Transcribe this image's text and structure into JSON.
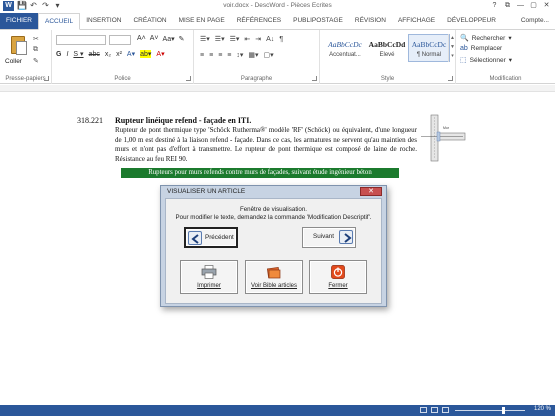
{
  "window": {
    "title": "voir.docx - DescWord - Pièces Ecrites",
    "controls": [
      "?",
      "⧉",
      "—",
      "▢",
      "✕"
    ]
  },
  "qat": {
    "logo": "W",
    "save": "💾",
    "undo": "↶",
    "redo": "↷",
    "more": "▾"
  },
  "tabs": [
    "FICHIER",
    "ACCUEIL",
    "INSERTION",
    "CRÉATION",
    "MISE EN PAGE",
    "RÉFÉRENCES",
    "PUBLIPOSTAGE",
    "RÉVISION",
    "AFFICHAGE",
    "DÉVELOPPEUR"
  ],
  "account": "Compte...",
  "ribbon": {
    "clipboard": {
      "paste_label": "Coller",
      "group_label": "Presse-papiers"
    },
    "font": {
      "group_label": "Police",
      "grow": "A˄",
      "shrink": "A˅",
      "case": "Aa▾",
      "clear": "✎",
      "bold": "G",
      "italic": "I",
      "underline": "S ▾",
      "strike": "abc",
      "sub": "x₂",
      "sup": "x²",
      "effects": "A▾",
      "highlight": "ab▾",
      "color": "A▾"
    },
    "paragraph": {
      "group_label": "Paragraphe",
      "row1": [
        "☰▾",
        "☰▾",
        "☰▾",
        "⇤",
        "⇥",
        "A↓",
        "¶"
      ],
      "row2": [
        "≡",
        "≡",
        "≡",
        "≡",
        "↕▾",
        "▦▾",
        "▢▾"
      ]
    },
    "styles": {
      "group_label": "Style",
      "items": [
        {
          "sample": "AaBbCcDc",
          "name": "Accentuat..."
        },
        {
          "sample": "AaBbCcDd",
          "name": "Elevé"
        },
        {
          "sample": "AaBbCcDc",
          "name": "¶ Normal"
        }
      ],
      "scroll": [
        "▲",
        "▼",
        "▾"
      ]
    },
    "modification": {
      "group_label": "Modification",
      "find": "Rechercher",
      "find_caret": "▾",
      "replace": "Remplacer",
      "select": "Sélectionner",
      "select_caret": "▾"
    }
  },
  "document": {
    "number": "318.221",
    "title": "Rupteur linéique refend - façade en ITI.",
    "body": "Rupteur de pont thermique type 'Schöck Rutherma®' modèle 'RF' (Schöck) ou équivalent, d'une longueur de 1,00 m est destiné à la liaison refend - façade. Dans ce cas, les armatures ne servent qu'au maintien des murs et n'ont pas d'effort à transmettre. Le rupteur de pont thermique est composé de laine de roche. Résistance au feu REI 90.",
    "highlight": "Rupteurs pour murs refends contre murs de façades, suivant étude ingénieur béton",
    "drawing_label": "Mur"
  },
  "dialog": {
    "title": "VISUALISER UN ARTICLE",
    "close": "✕",
    "message1": "Fenêtre de visualisation.",
    "message2": "Pour modifier le texte, demandez la commande 'Modification Descriptif'.",
    "prev": "Précédent",
    "next": "Suivant",
    "print": "Imprimer",
    "bible": "Voir Bible articles",
    "close_btn": "Fermer"
  },
  "status": {
    "zoom": "120 %"
  },
  "colors": {
    "accent": "#2b579a",
    "highlight_bg": "#1b7a2d",
    "dialog_frame": "#c7d3e3"
  }
}
